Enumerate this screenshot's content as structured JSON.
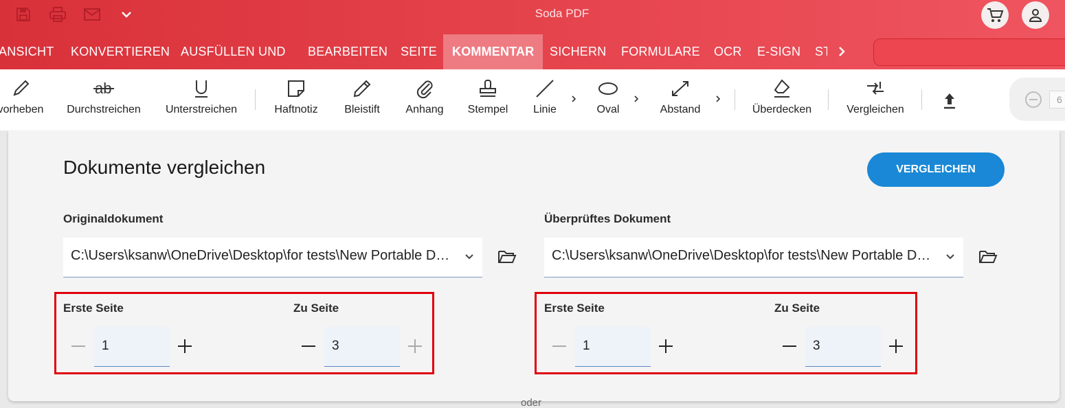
{
  "app": {
    "title": "Soda PDF"
  },
  "quick_access": [
    {
      "name": "save-icon"
    },
    {
      "name": "print-icon"
    },
    {
      "name": "mail-icon"
    },
    {
      "name": "chevron-down-icon"
    }
  ],
  "header_icons": [
    {
      "name": "cart-icon"
    },
    {
      "name": "account-icon"
    }
  ],
  "tabs": [
    {
      "label": "ANSICHT",
      "active": false
    },
    {
      "label": "KONVERTIEREN",
      "active": false
    },
    {
      "label": "AUSFÜLLEN UND",
      "active": false
    },
    {
      "label": "BEARBEITEN",
      "active": false
    },
    {
      "label": "SEITE",
      "active": false
    },
    {
      "label": "KOMMENTAR",
      "active": true
    },
    {
      "label": "SICHERN",
      "active": false
    },
    {
      "label": "FORMULARE",
      "active": false
    },
    {
      "label": "OCR",
      "active": false
    },
    {
      "label": "E-SIGN",
      "active": false
    },
    {
      "label": "ST",
      "active": false
    }
  ],
  "toolbar": [
    {
      "label": "vorheben",
      "icon": "highlighter-icon"
    },
    {
      "label": "Durchstreichen",
      "icon": "strikethrough-icon"
    },
    {
      "label": "Unterstreichen",
      "icon": "underline-icon"
    },
    {
      "label": "Haftnotiz",
      "icon": "sticky-note-icon"
    },
    {
      "label": "Bleistift",
      "icon": "pencil-icon"
    },
    {
      "label": "Anhang",
      "icon": "paperclip-icon"
    },
    {
      "label": "Stempel",
      "icon": "stamp-icon"
    },
    {
      "label": "Linie",
      "icon": "line-icon"
    },
    {
      "label": "Oval",
      "icon": "oval-icon"
    },
    {
      "label": "Abstand",
      "icon": "distance-icon"
    },
    {
      "label": "Überdecken",
      "icon": "eraser-icon"
    },
    {
      "label": "Vergleichen",
      "icon": "compare-icon"
    },
    {
      "label": "",
      "icon": "upload-icon"
    }
  ],
  "zoom": {
    "value": "6"
  },
  "dialog": {
    "title": "Dokumente vergleichen",
    "compare_button": "VERGLEICHEN",
    "original": {
      "label": "Originaldokument",
      "path": "C:\\Users\\ksanw\\OneDrive\\Desktop\\for tests\\New Portable Document Format.pdf",
      "first_page_label": "Erste Seite",
      "first_page": "1",
      "to_page_label": "Zu Seite",
      "to_page": "3"
    },
    "revised": {
      "label": "Überprüftes Dokument",
      "path": "C:\\Users\\ksanw\\OneDrive\\Desktop\\for tests\\New Portable Document Format.pdf",
      "first_page_label": "Erste Seite",
      "first_page": "1",
      "to_page_label": "Zu Seite",
      "to_page": "3"
    }
  },
  "footer_fragment": "oder",
  "colors": {
    "header_red": "#e5434c",
    "active_tab": "#ee7b82",
    "accent_blue": "#1a88d6",
    "highlight_red": "#e0000b"
  }
}
